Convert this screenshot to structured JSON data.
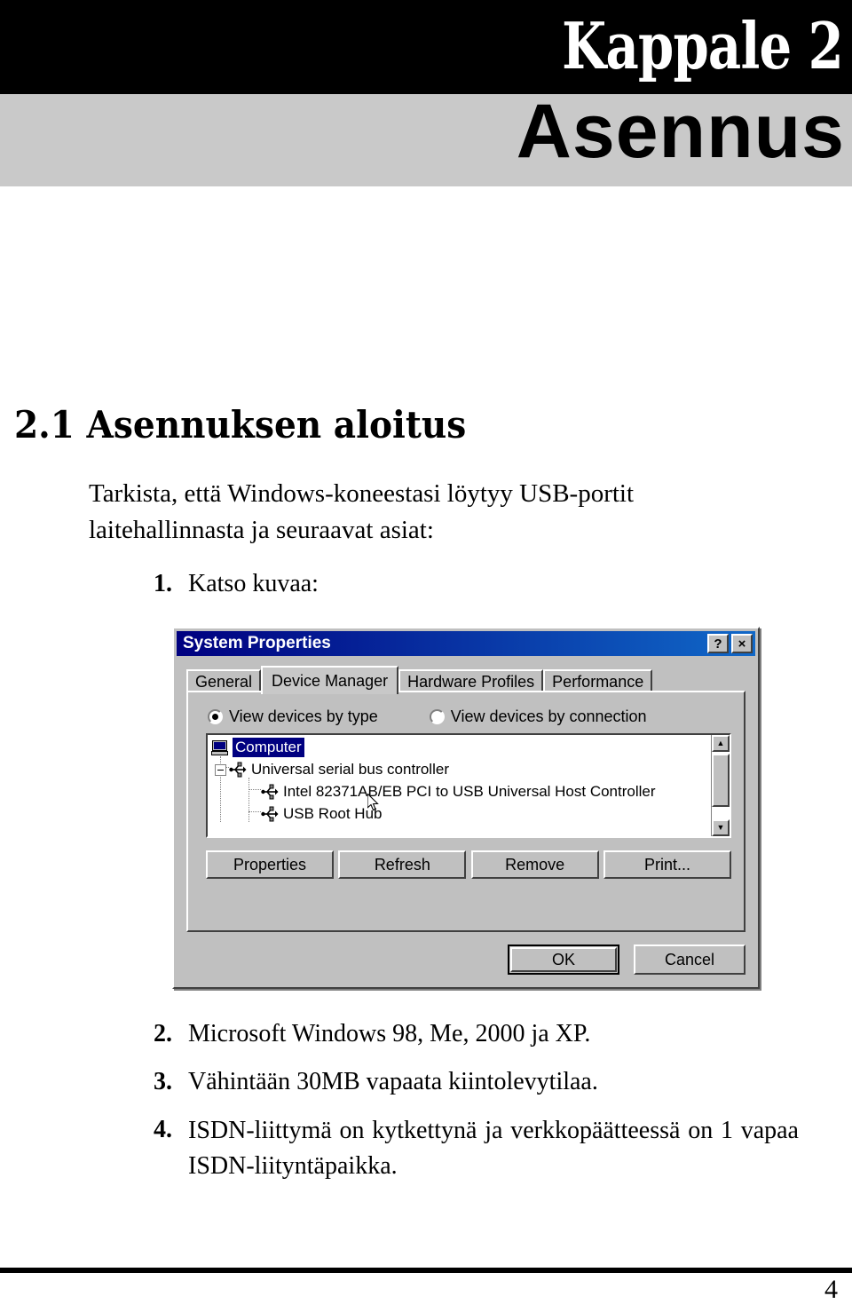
{
  "header": {
    "chapter": "Kappale 2",
    "title": "Asennus"
  },
  "section": {
    "heading": "2.1 Asennuksen aloitus",
    "intro": "Tarkista, että Windows-koneestasi löytyy USB-portit laitehallinnasta ja seuraavat asiat:"
  },
  "list": [
    {
      "num": "1.",
      "text": "Katso kuvaa:"
    },
    {
      "num": "2.",
      "text": "Microsoft Windows 98, Me, 2000 ja XP."
    },
    {
      "num": "3.",
      "text": "Vähintään 30MB vapaata kiintolevytilaa."
    },
    {
      "num": "4.",
      "text": "ISDN-liittymä on kytkettynä ja verkkopäätteessä on 1 vapaa ISDN-liityntäpaikka."
    }
  ],
  "dialog": {
    "title": "System Properties",
    "help_button": "?",
    "close_button": "×",
    "tabs": [
      {
        "label": "General",
        "active": false
      },
      {
        "label": "Device Manager",
        "active": true
      },
      {
        "label": "Hardware Profiles",
        "active": false
      },
      {
        "label": "Performance",
        "active": false
      }
    ],
    "view_options": [
      {
        "label": "View devices by type",
        "selected": true
      },
      {
        "label": "View devices by connection",
        "selected": false
      }
    ],
    "tree": [
      {
        "label": "Computer",
        "icon": "computer-icon",
        "selected": true,
        "level": 0
      },
      {
        "label": "Universal serial bus controller",
        "icon": "usb-icon",
        "selected": false,
        "level": 1,
        "expanded": true
      },
      {
        "label": "Intel 82371AB/EB PCI to USB Universal Host Controller",
        "icon": "usb-icon",
        "selected": false,
        "level": 2
      },
      {
        "label": "USB Root Hub",
        "icon": "usb-icon",
        "selected": false,
        "level": 2
      }
    ],
    "action_buttons": [
      "Properties",
      "Refresh",
      "Remove",
      "Print..."
    ],
    "dialog_buttons": [
      "OK",
      "Cancel"
    ],
    "scrollbar": {
      "up": "▲",
      "down": "▼"
    }
  },
  "footer": {
    "page_number": "4"
  },
  "colors": {
    "chapter_band": "#000000",
    "title_band": "#c9c9c9",
    "dialog_face": "#c0c0c0",
    "titlebar_start": "#000080",
    "titlebar_end": "#1068c8",
    "selection": "#000080"
  }
}
